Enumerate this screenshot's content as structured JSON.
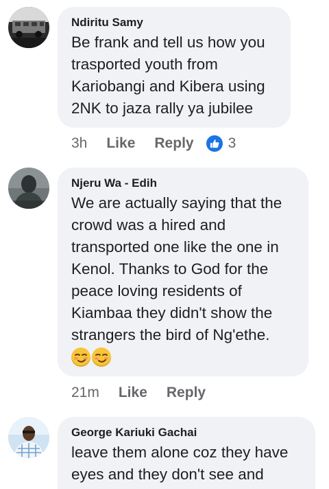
{
  "comments": [
    {
      "author": "Ndiritu Samy",
      "text": "Be frank and tell us how you\ntrasported youth from\nKariobangi and Kibera using\n2NK to jaza rally ya jubilee",
      "time": "3h",
      "like_label": "Like",
      "reply_label": "Reply",
      "reaction_count": "3",
      "reaction_icon": "like-icon"
    },
    {
      "author": "Njeru Wa - Edih",
      "text": "We are actually saying that the\ncrowd was a hired and\ntransported one like the one in\nKenol. Thanks to God for the\npeace loving residents of\nKiambaa they didn't show the\nstrangers the bird of Ng'ethe.",
      "emojis": [
        "smirking-face",
        "smirking-face"
      ],
      "time": "21m",
      "like_label": "Like",
      "reply_label": "Reply"
    },
    {
      "author": "George Kariuki Gachai",
      "text": "leave them alone coz they have\neyes and they don't see and"
    }
  ],
  "colors": {
    "bubble_bg": "#f0f2f5",
    "text": "#1c1e21",
    "meta": "#65676b",
    "like_blue": "#1b74e4"
  }
}
